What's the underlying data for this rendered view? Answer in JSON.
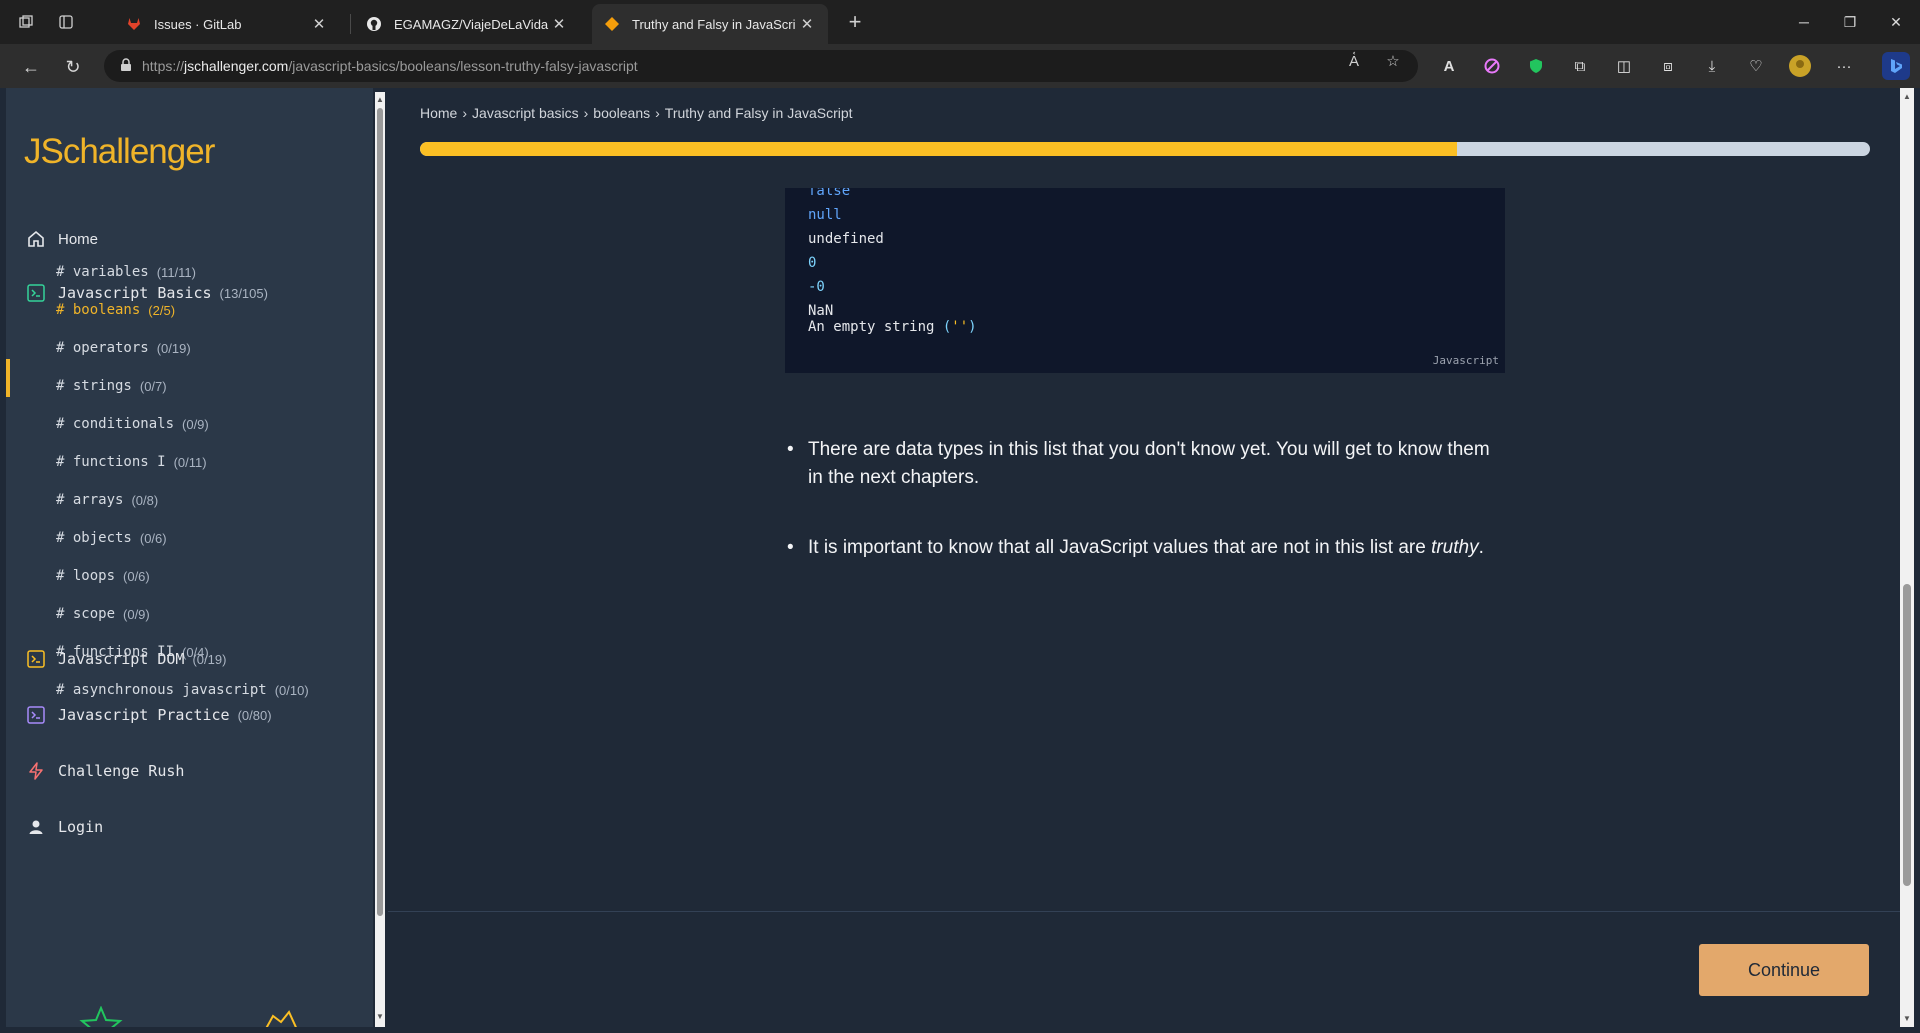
{
  "browser": {
    "tabs": [
      {
        "title": "Issues · GitLab",
        "favicon": "gitlab-icon"
      },
      {
        "title": "EGAMAGZ/ViajeDeLaVida",
        "favicon": "github-icon"
      },
      {
        "title": "Truthy and Falsy in JavaScri",
        "favicon": "jschallenger-icon"
      }
    ],
    "url_host": "https://jschallenger.com",
    "url_domain": "jschallenger.com",
    "url_path": "/javascript-basics/booleans/lesson-truthy-falsy-javascript",
    "url_prefix": "https://"
  },
  "sidebar": {
    "logo": "JSchallenger",
    "home_label": "Home",
    "sections": [
      {
        "label": "Javascript Basics",
        "count": "(13/105)",
        "icon_color": "#34d399"
      },
      {
        "label": "Javascript DOM",
        "count": "(0/19)",
        "icon_color": "#fbbf24"
      },
      {
        "label": "Javascript Practice",
        "count": "(0/80)",
        "icon_color": "#a78bfa"
      }
    ],
    "subitems": [
      {
        "label": "# variables",
        "count": "(11/11)"
      },
      {
        "label": "# booleans",
        "count": "(2/5)",
        "active": true
      },
      {
        "label": "# operators",
        "count": "(0/19)"
      },
      {
        "label": "# strings",
        "count": "(0/7)"
      },
      {
        "label": "# conditionals",
        "count": "(0/9)"
      },
      {
        "label": "# functions I",
        "count": "(0/11)"
      },
      {
        "label": "# arrays",
        "count": "(0/8)"
      },
      {
        "label": "# objects",
        "count": "(0/6)"
      },
      {
        "label": "# loops",
        "count": "(0/6)"
      },
      {
        "label": "# scope",
        "count": "(0/9)"
      },
      {
        "label": "# functions II",
        "count": "(0/4)"
      },
      {
        "label": "# asynchronous javascript",
        "count": "(0/10)"
      }
    ],
    "challenge_rush": "Challenge Rush",
    "login": "Login"
  },
  "main": {
    "breadcrumbs": [
      "Home",
      "Javascript basics",
      "booleans",
      "Truthy and Falsy in JavaScript"
    ],
    "progress_fraction": 0.715,
    "code": {
      "lines": [
        {
          "text": "false",
          "color": "#60a5fa"
        },
        {
          "text": "null",
          "color": "#60a5fa"
        },
        {
          "text": "undefined",
          "color": "#e5e7eb"
        },
        {
          "text": "0",
          "color": "#7dd3fc"
        },
        {
          "text": "-0",
          "color": "#7dd3fc"
        },
        {
          "text": "NaN",
          "color": "#e5e7eb"
        }
      ],
      "last_line_text": "An empty string ",
      "last_line_paren_open": "(",
      "last_line_quotes": "''",
      "last_line_paren_close": ")",
      "language": "Javascript"
    },
    "bullet1": "There are data types in this list that you don't know yet. You will get to know them in the next chapters.",
    "bullet2_text": "It is important to know that all JavaScript values that are not in this list are ",
    "bullet2_em": "truthy",
    "bullet2_end": ".",
    "continue_label": "Continue"
  },
  "colors": {
    "accent": "#f0b429",
    "progress_fill": "#fbbf24",
    "continue_bg": "#e3a86b"
  }
}
